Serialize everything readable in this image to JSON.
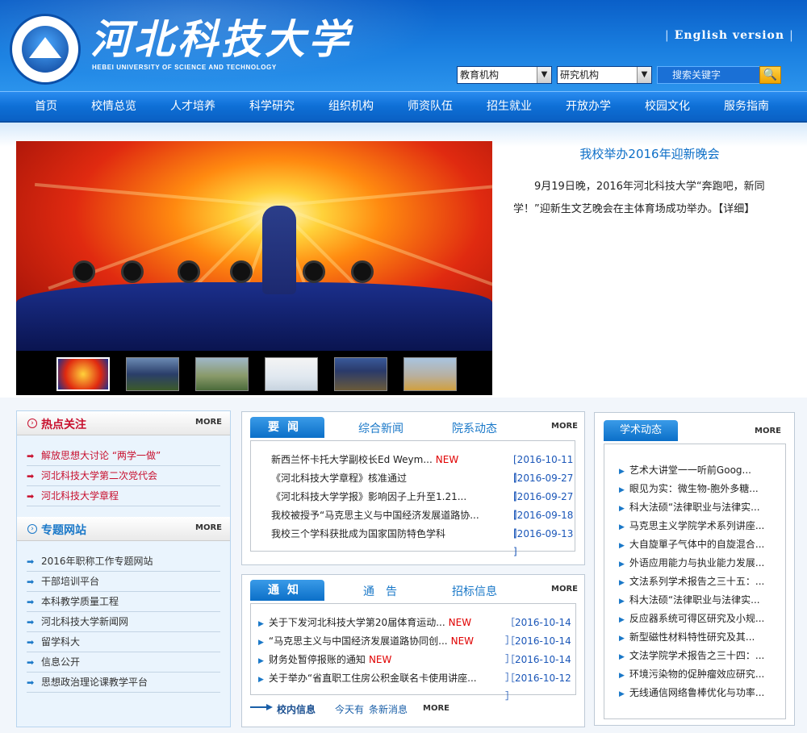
{
  "header": {
    "title": "河北科技大学",
    "subtitle": "HEBEI UNIVERSITY OF SCIENCE AND TECHNOLOGY",
    "english_link": "English version",
    "select1": "教育机构",
    "select2": "研究机构",
    "search_placeholder": "搜索关键字"
  },
  "nav": [
    "首页",
    "校情总览",
    "人才培养",
    "科学研究",
    "组织机构",
    "师资队伍",
    "招生就业",
    "开放办学",
    "校园文化",
    "服务指南"
  ],
  "headline": {
    "title": "我校举办2016年迎新晚会",
    "text": "9月19日晚，2016年河北科技大学“奔跑吧，新同学！”迎新生文艺晚会在主体育场成功举办。【详细】"
  },
  "hot": {
    "title": "热点关注",
    "more": "MORE",
    "items": [
      "解放思想大讨论 “两学一做”",
      "河北科技大学第二次党代会",
      "河北科技大学章程"
    ]
  },
  "special": {
    "title": "专题网站",
    "more": "MORE",
    "items": [
      "2016年职称工作专题网站",
      "干部培训平台",
      "本科教学质量工程",
      "河北科技大学新闻网",
      "留学科大",
      "信息公开",
      "思想政治理论课教学平台"
    ]
  },
  "news": {
    "tab_active": "要闻",
    "tab2": "综合新闻",
    "tab3": "院系动态",
    "more": "MORE",
    "new_label": "NEW",
    "rows": [
      {
        "text": "新西兰怀卡托大学副校长Ed Weym...",
        "date": "[2016-10-11 ]"
      },
      {
        "text": "《河北科技大学章程》核准通过",
        "date": "[2016-09-27 ]"
      },
      {
        "text": "《河北科技大学学报》影响因子上升至1.21...",
        "date": "[2016-09-27 ]"
      },
      {
        "text": "我校被授予“马克思主义与中国经济发展道路协...",
        "date": "[2016-09-18 ]"
      },
      {
        "text": "我校三个学科获批成为国家国防特色学科",
        "date": "[2016-09-13 ]"
      }
    ]
  },
  "notice": {
    "tab_active": "通知",
    "tab2": "通　告",
    "tab3": "招标信息",
    "more": "MORE",
    "new_label": "NEW",
    "rows": [
      {
        "text": "关于下发河北科技大学第20届体育运动...",
        "date": "［2016-10-14 ］"
      },
      {
        "text": "“马克思主义与中国经济发展道路协同创...",
        "date": "［2016-10-14 ］"
      },
      {
        "text": "财务处暂停报账的通知",
        "date": "［2016-10-14 ］"
      },
      {
        "text": "关于举办“省直职工住房公积金联名卡使用讲座...",
        "date": "［2016-10-12 ］"
      }
    ],
    "footer_title": "校内信息",
    "footer_link1": "今天有",
    "footer_link2": "条新消息",
    "footer_more": "MORE"
  },
  "academic": {
    "tab": "学术动态",
    "more": "MORE",
    "items": [
      "艺术大讲堂一一听前Goog...",
      "眼见为实：微生物-胞外多糖...",
      "科大法硕“法律职业与法律实...",
      "马克思主义学院学术系列讲座...",
      "大自旋單子气体中的自旋混合...",
      "外语应用能力与执业能力发展...",
      "文法系列学术报告之三十五：...",
      "科大法硕“法律职业与法律实...",
      "反应器系统可得区研究及小规...",
      "新型磁性材料特性研究及其...",
      "文法学院学术报告之三十四：...",
      "环境污染物的促肿瘤效应研究...",
      "无线通信网络鲁棒优化与功率..."
    ]
  }
}
